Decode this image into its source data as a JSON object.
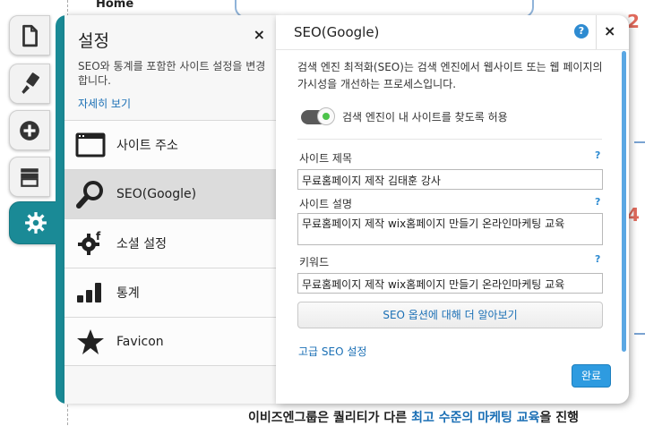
{
  "background": {
    "home_label": "Home",
    "digit_top": "2",
    "digit_mid": "4",
    "bottom_text_before": "이비즈엔그룹은 퀄리티가 다른 ",
    "bottom_text_highlight": "최고 수준의 마케팅 교육",
    "bottom_text_after": "을 진행"
  },
  "toolbar": {
    "items": [
      {
        "name": "pages",
        "icon": "page-icon"
      },
      {
        "name": "design",
        "icon": "paintbrush-icon"
      },
      {
        "name": "add",
        "icon": "plus-circle-icon"
      },
      {
        "name": "store",
        "icon": "store-icon"
      },
      {
        "name": "settings",
        "icon": "gear-icon",
        "active": true
      }
    ]
  },
  "settings": {
    "title": "설정",
    "close": "×",
    "description": "SEO와 통계를 포함한 사이트 설정을 변경합니다.",
    "more_link": "자세히 보기",
    "menu": [
      {
        "label": "사이트 주소",
        "icon": "browser-window-icon"
      },
      {
        "label": "SEO(Google)",
        "icon": "magnifier-icon",
        "selected": true
      },
      {
        "label": "소셜 설정",
        "icon": "social-gear-icon"
      },
      {
        "label": "통계",
        "icon": "bar-stats-icon"
      },
      {
        "label": "Favicon",
        "icon": "star-icon"
      }
    ]
  },
  "seo": {
    "title": "SEO(Google)",
    "help": "?",
    "close": "×",
    "description": "검색 엔진 최적화(SEO)는 검색 엔진에서 웹사이트 또는 웹 페이지의 가시성을 개선하는 프로세스입니다.",
    "toggle_label": "검색 엔진이 내 사이트를 찾도록 허용",
    "toggle_on": true,
    "fields": {
      "site_title": {
        "label": "사이트 제목",
        "value": "무료홈페이지 제작 김태훈 강사",
        "help": "?"
      },
      "site_description": {
        "label": "사이트 설명",
        "value": "무료홈페이지 제작 wix홈페이지 만들기 온라인마케팅 교육",
        "help": "?"
      },
      "keywords": {
        "label": "키워드",
        "value": "무료홈페이지 제작 wix홈페이지 만들기 온라인마케팅 교육",
        "help": "?"
      }
    },
    "learn_button": "SEO 옵션에 대해 더 알아보기",
    "advanced_link": "고급 SEO 설정",
    "done_button": "완료"
  },
  "colors": {
    "accent_teal": "#1a8a96",
    "link_blue": "#1a6fb5",
    "done_blue": "#2e9be0",
    "toggle_green": "#4cc34a"
  }
}
